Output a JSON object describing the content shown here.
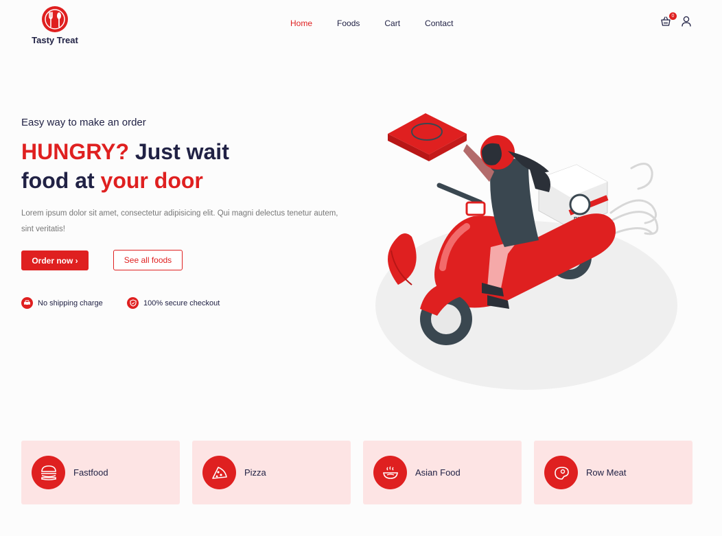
{
  "brand": {
    "name": "Tasty Treat",
    "accent": "#df2020",
    "dark": "#212245"
  },
  "nav": {
    "items": [
      {
        "label": "Home",
        "active": true
      },
      {
        "label": "Foods",
        "active": false
      },
      {
        "label": "Cart",
        "active": false
      },
      {
        "label": "Contact",
        "active": false
      }
    ]
  },
  "header": {
    "cart_count": "0",
    "cart_icon": "basket-icon",
    "user_icon": "user-icon"
  },
  "hero": {
    "subtitle": "Easy way to make an order",
    "title_part1": "HUNGRY?",
    "title_part2": " Just wait",
    "title_part3": "food at ",
    "title_part4": "your door",
    "description": "Lorem ipsum dolor sit amet, consectetur adipisicing elit. Qui magni delectus tenetur autem, sint veritatis!",
    "order_button": "Order now ›",
    "all_foods_button": "See all foods",
    "features": [
      {
        "label": "No shipping charge",
        "icon": "car-icon"
      },
      {
        "label": "100% secure checkout",
        "icon": "shield-icon"
      }
    ],
    "illustration_text": "PIZZA"
  },
  "categories": [
    {
      "label": "Fastfood",
      "icon": "burger-icon"
    },
    {
      "label": "Pizza",
      "icon": "pizza-icon"
    },
    {
      "label": "Asian Food",
      "icon": "noodles-icon"
    },
    {
      "label": "Row Meat",
      "icon": "meat-icon"
    }
  ]
}
